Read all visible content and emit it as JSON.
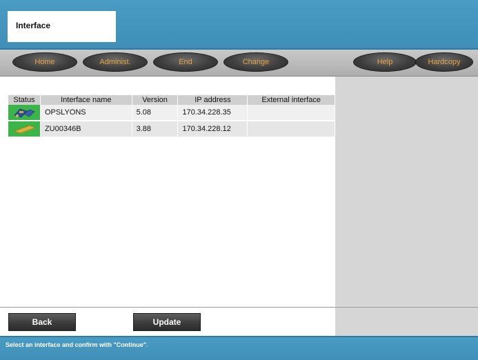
{
  "header": {
    "title": "Interface"
  },
  "toolbar": {
    "buttons": [
      {
        "label": "Home"
      },
      {
        "label": "Administ."
      },
      {
        "label": "End"
      },
      {
        "label": "Change"
      },
      {
        "label": "Help"
      },
      {
        "label": "Hardcopy"
      }
    ]
  },
  "table": {
    "columns": [
      "Status",
      "Interface name",
      "Version",
      "IP address",
      "External interface"
    ],
    "rows": [
      {
        "status_icon": "network-device-icon",
        "name": "OPSLYONS",
        "version": "5.08",
        "ip": "170.34.228.35",
        "external": ""
      },
      {
        "status_icon": "device-box-icon",
        "name": "ZU00346B",
        "version": "3.88",
        "ip": "170.34.228.12",
        "external": ""
      }
    ]
  },
  "actions": {
    "back_label": "Back",
    "update_label": "Update"
  },
  "status_message": "Select an interface and confirm with \"Continue\".",
  "colors": {
    "accent_blue": "#4a9cc4",
    "toolbar_text": "#e8a33a",
    "status_ok": "#3bb54a"
  }
}
